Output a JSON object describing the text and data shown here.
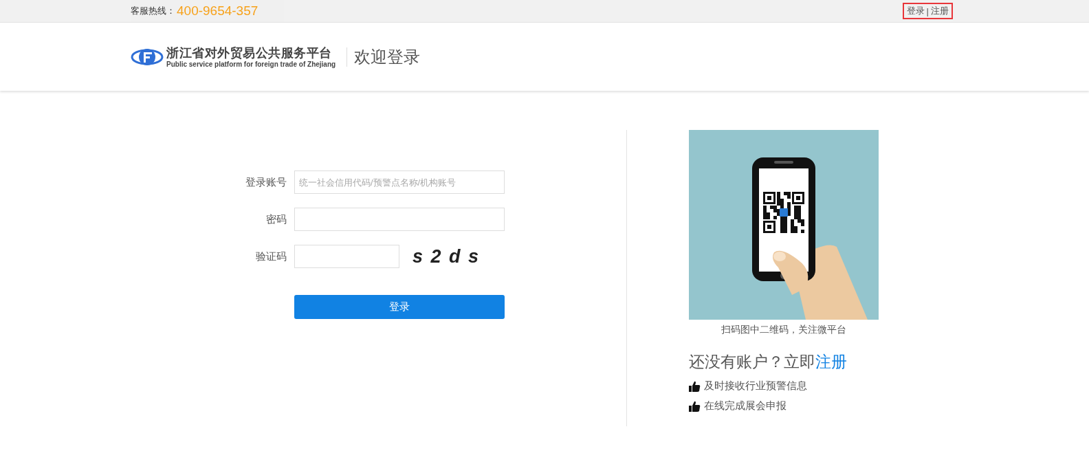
{
  "top_bar": {
    "hotline_label": "客服热线：",
    "hotline_number": "400-9654-357",
    "links": [
      {
        "label": "登录"
      },
      {
        "label": "注册"
      }
    ],
    "separator": "|"
  },
  "header": {
    "logo_title": "浙江省对外贸易公共服务平台",
    "logo_subtitle": "Public service platform for foreign trade of Zhejiang",
    "page_title": "欢迎登录"
  },
  "login_form": {
    "fields": [
      {
        "label": "登录账号",
        "kind": "text",
        "placeholder": "统一社会信用代码/预警点名称/机构账号"
      },
      {
        "label": "密码",
        "kind": "password"
      },
      {
        "label": "验证码",
        "kind": "captcha",
        "captcha": "s 2 d s"
      }
    ],
    "submit": "登录"
  },
  "promo": {
    "qr_caption": "扫码图中二维码，关注微平台",
    "signup_prompt": "还没有账户？立即",
    "signup_link": "注册",
    "benefits": [
      "及时接收行业预警信息",
      "在线完成展会申报"
    ]
  }
}
